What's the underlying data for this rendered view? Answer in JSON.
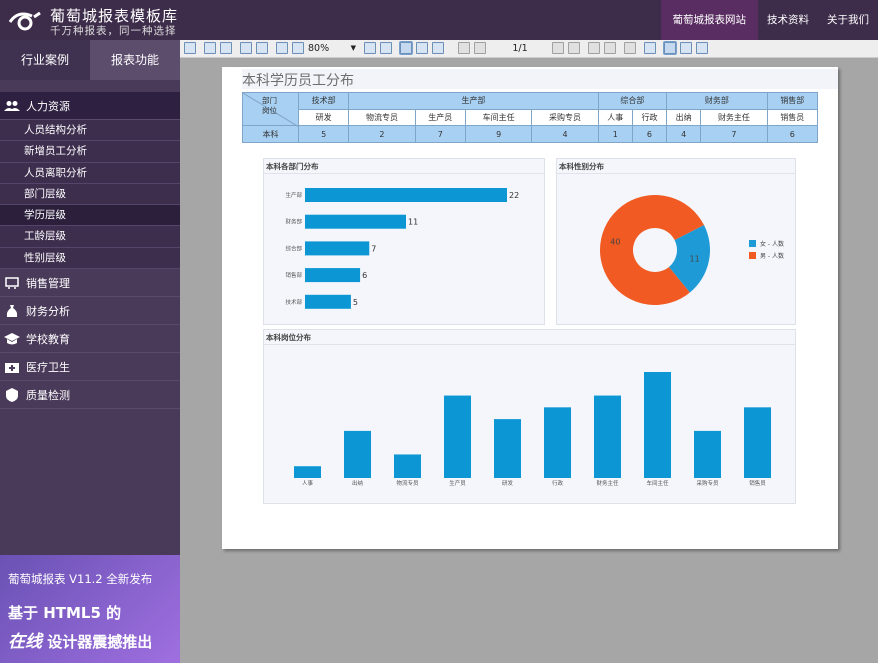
{
  "header": {
    "brand_title": "葡萄城报表模板库",
    "brand_subtitle": "千万种报表，同一种选择",
    "nav": [
      "葡萄城报表网站",
      "技术资料",
      "关于我们"
    ]
  },
  "sidebar": {
    "tabs": [
      "行业案例",
      "报表功能"
    ],
    "menu": [
      {
        "label": "人力资源",
        "icon": "people-icon",
        "active": true,
        "items": [
          "人员结构分析",
          "新增员工分析",
          "人员离职分析",
          "部门层级",
          "学历层级",
          "工龄层级",
          "性别层级"
        ],
        "active_item": 4
      },
      {
        "label": "销售管理",
        "icon": "cart-icon"
      },
      {
        "label": "财务分析",
        "icon": "money-bag-icon"
      },
      {
        "label": "学校教育",
        "icon": "graduation-cap-icon"
      },
      {
        "label": "医疗卫生",
        "icon": "medical-kit-icon"
      },
      {
        "label": "质量检测",
        "icon": "quality-badge-icon"
      }
    ],
    "promo": {
      "line1": "葡萄城报表 V11.2 全新发布",
      "line2": "基于 HTML5 的",
      "line3_em": "在线",
      "line3_rest": " 设计器震撼推出"
    }
  },
  "toolbar": {
    "zoom": "80%",
    "page": "1/1"
  },
  "report": {
    "title": "本科学历员工分布",
    "corner_top": "部门",
    "corner_bottom": "岗位",
    "departments": [
      {
        "name": "技术部",
        "span": 1
      },
      {
        "name": "生产部",
        "span": 4
      },
      {
        "name": "综合部",
        "span": 2
      },
      {
        "name": "财务部",
        "span": 2
      },
      {
        "name": "销售部",
        "span": 1
      }
    ],
    "positions": [
      "研发",
      "物流专员",
      "生产员",
      "车间主任",
      "采购专员",
      "人事",
      "行政",
      "出纳",
      "财务主任",
      "销售员"
    ],
    "row_label": "本科",
    "row_values": [
      "5",
      "2",
      "7",
      "9",
      "4",
      "1",
      "6",
      "4",
      "7",
      "6"
    ]
  },
  "chart_data": [
    {
      "type": "bar",
      "title": "本科各部门分布",
      "orientation": "horizontal",
      "categories": [
        "生产部",
        "财务部",
        "综合部",
        "销售部",
        "技术部"
      ],
      "values": [
        22,
        11,
        7,
        6,
        5
      ],
      "xlim": [
        0,
        22
      ],
      "color": "#0c97d4"
    },
    {
      "type": "pie",
      "title": "本科性别分布",
      "donut": true,
      "slices": [
        {
          "name": "女 - 人数",
          "value": 11,
          "color": "#1e9bd7"
        },
        {
          "name": "男 - 人数",
          "value": 40,
          "color": "#f15a22"
        }
      ],
      "legend_position": "right"
    },
    {
      "type": "bar",
      "title": "本科岗位分布",
      "categories": [
        "人事",
        "出纳",
        "物流专员",
        "生产员",
        "研发",
        "行政",
        "财务主任",
        "车间主任",
        "采购专员",
        "销售员"
      ],
      "values": [
        1,
        4,
        2,
        7,
        5,
        6,
        7,
        9,
        4,
        6
      ],
      "ylim": [
        0,
        9
      ],
      "color": "#0c97d4"
    }
  ]
}
